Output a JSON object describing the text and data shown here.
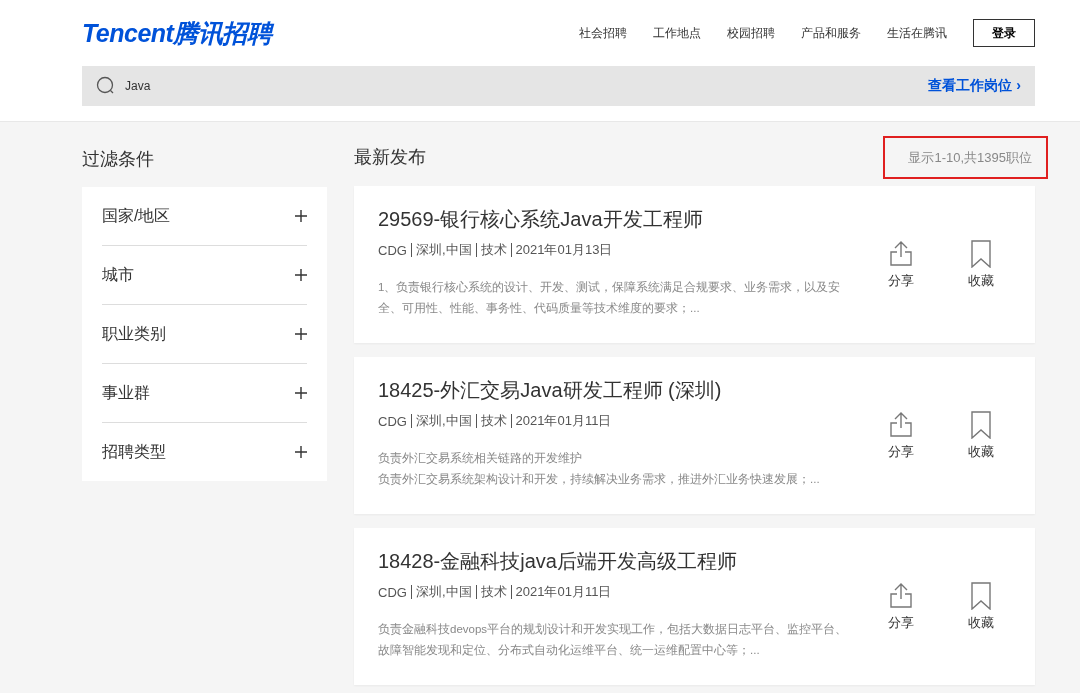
{
  "header": {
    "logo": "Tencent腾讯招聘",
    "nav": [
      "社会招聘",
      "工作地点",
      "校园招聘",
      "产品和服务",
      "生活在腾讯"
    ],
    "login": "登录"
  },
  "search": {
    "value": "Java",
    "link": "查看工作岗位",
    "link_arrow": "›"
  },
  "filter": {
    "title": "过滤条件",
    "items": [
      {
        "label": "国家/地区",
        "expanded": false
      },
      {
        "label": "城市",
        "expanded": false
      },
      {
        "label": "职业类别",
        "expanded": false
      },
      {
        "label": "事业群",
        "expanded": false
      },
      {
        "label": "招聘类型",
        "expanded": false
      }
    ]
  },
  "list": {
    "title": "最新发布",
    "count": "显示1-10,共1395职位",
    "count_highlighted": true,
    "jobs": [
      {
        "title": "29569-银行核心系统Java开发工程师",
        "meta": [
          "CDG",
          "深圳,中国",
          "技术",
          "2021年01月13日"
        ],
        "description": [
          "1、负责银行核心系统的设计、开发、测试，保障系统满足合规要求、业务需求，以及安全、可用性、性能、事务性、代码质量等技术维度的要求；..."
        ],
        "share": "分享",
        "save": "收藏"
      },
      {
        "title": "18425-外汇交易Java研发工程师 (深圳)",
        "meta": [
          "CDG",
          "深圳,中国",
          "技术",
          "2021年01月11日"
        ],
        "description": [
          "负责外汇交易系统相关链路的开发维护",
          "负责外汇交易系统架构设计和开发，持续解决业务需求，推进外汇业务快速发展；..."
        ],
        "share": "分享",
        "save": "收藏"
      },
      {
        "title": "18428-金融科技java后端开发高级工程师",
        "meta": [
          "CDG",
          "深圳,中国",
          "技术",
          "2021年01月11日"
        ],
        "description": [
          "负责金融科技devops平台的规划设计和开发实现工作，包括大数据日志平台、监控平台、故障智能发现和定位、分布式自动化运维平台、统一运维配置中心等；..."
        ],
        "share": "分享",
        "save": "收藏"
      }
    ]
  }
}
